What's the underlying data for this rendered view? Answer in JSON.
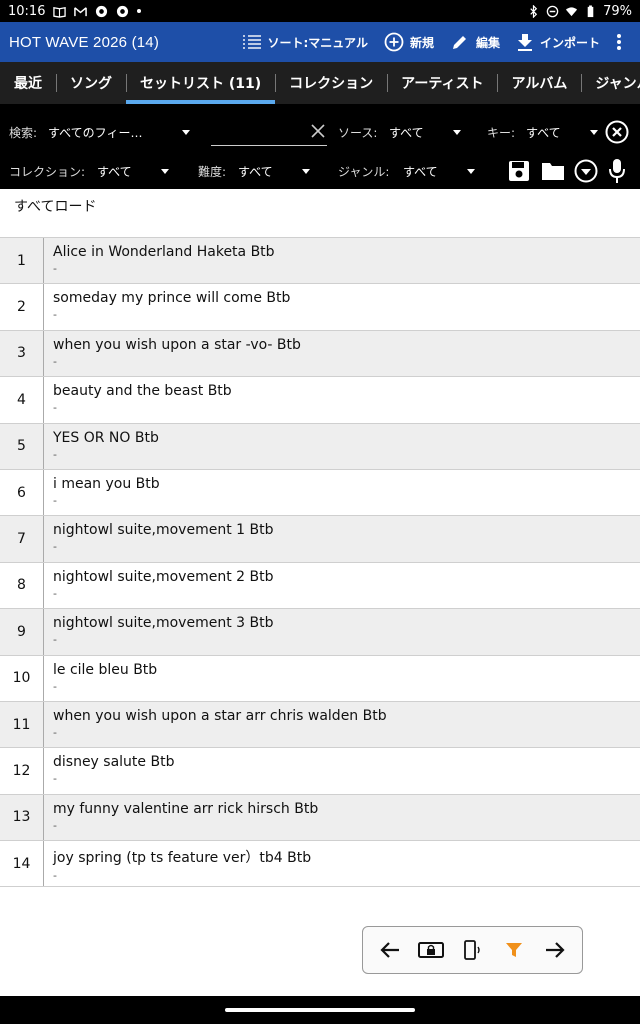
{
  "status": {
    "time": "10:16",
    "battery": "79%"
  },
  "appbar": {
    "title": "HOT WAVE 2026 (14)",
    "sort_label": "ソート:マニュアル",
    "new_label": "新規",
    "edit_label": "編集",
    "import_label": "インポート"
  },
  "tabs": [
    {
      "label": "最近"
    },
    {
      "label": "ソング"
    },
    {
      "label": "セットリスト (11)"
    },
    {
      "label": "コレクション"
    },
    {
      "label": "アーティスト"
    },
    {
      "label": "アルバム"
    },
    {
      "label": "ジャンル"
    }
  ],
  "filters": {
    "search_label": "検索:",
    "search_scope": "すべてのフィー…",
    "search_value": "",
    "source_label": "ソース:",
    "source_value": "すべて",
    "key_label": "キー:",
    "key_value": "すべて",
    "collection_label": "コレクション:",
    "collection_value": "すべて",
    "difficulty_label": "難度:",
    "difficulty_value": "すべて",
    "genre_label": "ジャンル:",
    "genre_value": "すべて"
  },
  "load_all": "すべてロード",
  "songs": [
    {
      "num": "1",
      "title": "Alice in Wonderland Haketa Btb",
      "sub": "-"
    },
    {
      "num": "2",
      "title": "someday my prince will come Btb",
      "sub": "-"
    },
    {
      "num": "3",
      "title": "when you wish upon a star -vo- Btb",
      "sub": "-"
    },
    {
      "num": "4",
      "title": "beauty and the beast Btb",
      "sub": "-"
    },
    {
      "num": "5",
      "title": "YES OR NO Btb",
      "sub": "-"
    },
    {
      "num": "6",
      "title": "i mean you Btb",
      "sub": "-"
    },
    {
      "num": "7",
      "title": "nightowl suite,movement 1 Btb",
      "sub": "-"
    },
    {
      "num": "8",
      "title": "nightowl suite,movement 2 Btb",
      "sub": "-"
    },
    {
      "num": "9",
      "title": "nightowl suite,movement 3 Btb",
      "sub": "-"
    },
    {
      "num": "10",
      "title": "le cile bleu Btb",
      "sub": "-"
    },
    {
      "num": "11",
      "title": "when you wish upon a star arr chris walden Btb",
      "sub": "-"
    },
    {
      "num": "12",
      "title": "disney salute Btb",
      "sub": "-"
    },
    {
      "num": "13",
      "title": "my funny valentine arr rick hirsch Btb",
      "sub": "-"
    },
    {
      "num": "14",
      "title": "joy spring (tp ts feature ver）tb4 Btb",
      "sub": "-"
    }
  ],
  "colors": {
    "appbar": "#1e4fa8",
    "tab_indicator": "#5aa9ee",
    "filter_icon": "#f0901a"
  }
}
